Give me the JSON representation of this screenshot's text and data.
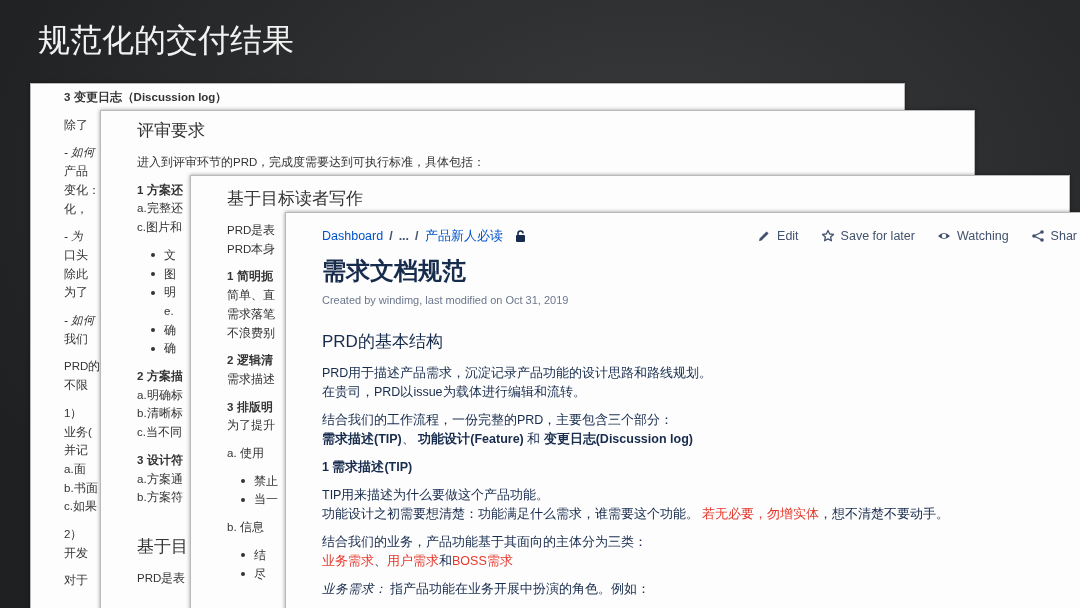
{
  "slide": {
    "title": "规范化的交付结果"
  },
  "documents": [
    {
      "blocks": [
        {
          "kind": "para",
          "lines": [
            "**3 变更日志（Discussion log）**"
          ]
        },
        {
          "kind": "para",
          "lines": [
            "除了"
          ]
        },
        {
          "kind": "para",
          "lines": [
            "*- 如何*",
            "产品",
            "变化：",
            "化，"
          ]
        },
        {
          "kind": "para",
          "lines": [
            "*- 为*",
            "口头",
            "除此",
            "为了"
          ]
        },
        {
          "kind": "para",
          "lines": [
            "*- 如何*",
            "我们"
          ]
        },
        {
          "kind": "para",
          "lines": [
            "PRD的",
            "不限"
          ]
        },
        {
          "kind": "para",
          "lines": [
            "1）",
            "业务(",
            "并记",
            "a.面",
            "b.书面",
            "c.如果"
          ]
        },
        {
          "kind": "para",
          "lines": [
            "2）",
            "开发"
          ]
        },
        {
          "kind": "para",
          "lines": [
            "对于"
          ]
        }
      ]
    },
    {
      "blocks": [
        {
          "kind": "heading",
          "lines": [
            "评审要求"
          ]
        },
        {
          "kind": "para",
          "lines": [
            "进入到评审环节的PRD，完成度需要达到可执行标准，具体包括："
          ]
        },
        {
          "kind": "para",
          "lines": [
            "**1 方案还**",
            "a.完整还",
            "c.图片和"
          ]
        },
        {
          "kind": "bullets",
          "lines": [
            "文",
            "图",
            "明"
          ]
        },
        {
          "kind": "indent",
          "lines": [
            "e."
          ]
        },
        {
          "kind": "bullets",
          "lines": [
            "确",
            "确"
          ]
        },
        {
          "kind": "para",
          "lines": [
            "**2 方案描**",
            "a.明确标",
            "b.清晰标",
            "c.当不同"
          ]
        },
        {
          "kind": "para",
          "lines": [
            "**3 设计符**",
            "a.方案通",
            "b.方案符"
          ]
        },
        {
          "kind": "heading",
          "lines": [
            "基于目"
          ]
        },
        {
          "kind": "para",
          "lines": [
            "PRD是表"
          ]
        }
      ]
    },
    {
      "blocks": [
        {
          "kind": "heading",
          "lines": [
            "基于目标读者写作"
          ]
        },
        {
          "kind": "para",
          "lines": [
            "PRD是表",
            "PRD本身"
          ]
        },
        {
          "kind": "para",
          "lines": [
            "**1 简明扼**",
            "简单、直",
            "需求落笔",
            "不浪费别"
          ]
        },
        {
          "kind": "para",
          "lines": [
            "**2 逻辑清**",
            "需求描述"
          ]
        },
        {
          "kind": "para",
          "lines": [
            "**3 排版明**",
            "为了提升"
          ]
        },
        {
          "kind": "para",
          "lines": [
            "a. 使用"
          ]
        },
        {
          "kind": "bullets",
          "lines": [
            "禁止",
            "当一"
          ]
        },
        {
          "kind": "para",
          "lines": [
            "b. 信息"
          ]
        },
        {
          "kind": "bullets",
          "lines": [
            "结",
            "尽"
          ]
        }
      ]
    },
    {
      "breadcrumb": [
        {
          "text": "Dashboard",
          "kind": "link"
        },
        {
          "text": "/",
          "kind": "sep"
        },
        {
          "text": "...",
          "kind": "sep"
        },
        {
          "text": "/",
          "kind": "sep"
        },
        {
          "text": "产品新人必读",
          "kind": "link"
        }
      ],
      "actions": [
        "Edit",
        "Save for later",
        "Watching",
        "Shar"
      ],
      "title": "需求文档规范",
      "meta": "Created by windimg, last modified on Oct 31, 2019",
      "blocks": [
        {
          "kind": "heading",
          "lines": [
            "PRD的基本结构"
          ]
        },
        {
          "kind": "para",
          "lines": [
            "PRD用于描述产品需求，沉淀记录产品功能的设计思路和路线规划。",
            "在贵司，PRD以issue为载体进行编辑和流转。"
          ]
        },
        {
          "kind": "para",
          "lines": [
            "结合我们的工作流程，一份完整的PRD，主要包含三个部分：",
            "**需求描述(TIP)**、 **功能设计(Feature)** 和 **变更日志(Discussion log)**"
          ]
        },
        {
          "kind": "para",
          "lines": [
            "1 需求描述(TIP)"
          ],
          "bold": true
        },
        {
          "kind": "para",
          "lines": [
            "TIP用来描述为什么要做这个产品功能。",
            [
              {
                "text": "功能设计之初需要想清楚：功能满足什么需求，谁需要这个功能。 ",
                "highlighted": false
              },
              {
                "text": "若无必要，勿增实体",
                "highlighted": true
              },
              {
                "text": "，想不清楚不要动手。",
                "highlighted": false
              }
            ]
          ]
        },
        {
          "kind": "para",
          "lines": [
            "结合我们的业务，产品功能基于其面向的主体分为三类：",
            [
              {
                "text": "业务需求",
                "highlighted": true
              },
              {
                "text": "、",
                "highlighted": false
              },
              {
                "text": "用户需求",
                "highlighted": true
              },
              {
                "text": "和",
                "highlighted": false
              },
              {
                "text": "BOSS需求",
                "highlighted": true
              }
            ]
          ]
        },
        {
          "kind": "para",
          "lines": [
            "*业务需求：* 指产品功能在业务开展中扮演的角色。例如："
          ]
        }
      ]
    }
  ]
}
